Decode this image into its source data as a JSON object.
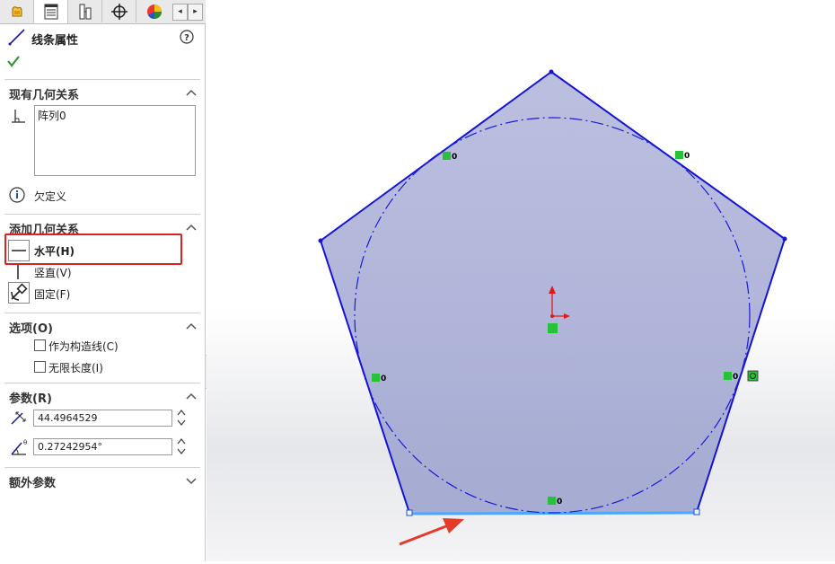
{
  "panel": {
    "title": "线条属性",
    "help_icon": "question-icon",
    "existing_relations": {
      "title": "现有几何关系",
      "items": [
        "阵列0"
      ],
      "status": "欠定义"
    },
    "add_relations": {
      "title": "添加几何关系",
      "items": [
        {
          "label": "水平(H)",
          "icon": "horizontal-icon",
          "bold": true
        },
        {
          "label": "竖直(V)",
          "icon": "vertical-icon"
        },
        {
          "label": "固定(F)",
          "icon": "fix-icon"
        }
      ]
    },
    "options": {
      "title": "选项(O)",
      "items": [
        {
          "label": "作为构造线(C)",
          "checked": false
        },
        {
          "label": "无限长度(I)",
          "checked": false
        }
      ]
    },
    "parameters": {
      "title": "参数(R)",
      "length": "44.4964529",
      "angle": "0.27242954°"
    },
    "extra": {
      "title": "额外参数"
    }
  },
  "canvas": {
    "relation_badges": [
      "0",
      "0",
      "0",
      "0",
      "0"
    ],
    "colors": {
      "fill": "#aab0d6",
      "edge": "#1414d2",
      "selected_edge": "#4da6ff",
      "arrow": "#e53a2a",
      "badge": "#27c13a"
    }
  }
}
